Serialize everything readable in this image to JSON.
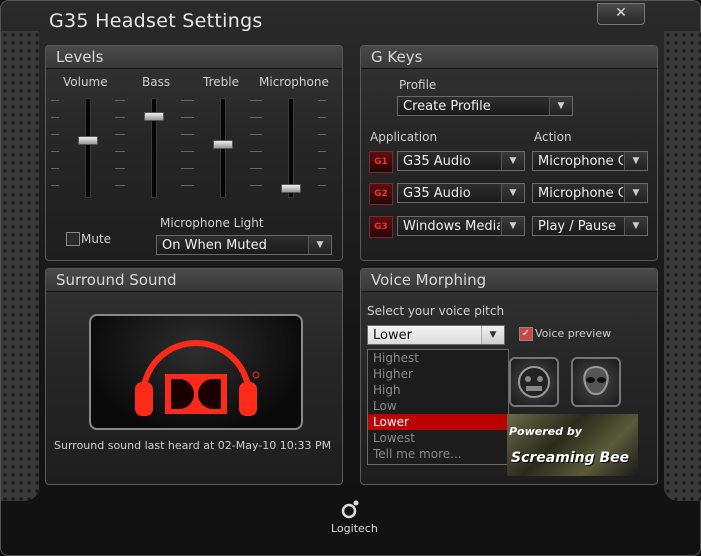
{
  "window": {
    "title": "G35 Headset Settings",
    "close_label": "✕"
  },
  "levels": {
    "title": "Levels",
    "sliders": [
      {
        "label": "Volume",
        "level": 0.58
      },
      {
        "label": "Bass",
        "level": 0.84
      },
      {
        "label": "Treble",
        "level": 0.53
      },
      {
        "label": "Microphone",
        "level": 0.05
      }
    ],
    "mute_label": "Mute",
    "mute_checked": false,
    "mic_light_label": "Microphone Light",
    "mic_light_value": "On When Muted"
  },
  "gkeys": {
    "title": "G Keys",
    "profile_label": "Profile",
    "profile_value": "Create Profile",
    "application_label": "Application",
    "action_label": "Action",
    "rows": [
      {
        "key": "G1",
        "application": "G35 Audio",
        "action": "Microphone Gain"
      },
      {
        "key": "G2",
        "application": "G35 Audio",
        "action": "Microphone Gain"
      },
      {
        "key": "G3",
        "application": "Windows Media Player",
        "action": "Play / Pause"
      }
    ]
  },
  "surround": {
    "title": "Surround Sound",
    "status": "Surround sound last heard at 02-May-10 10:33 PM"
  },
  "voice": {
    "title": "Voice Morphing",
    "pitch_label": "Select your voice pitch",
    "pitch_value": "Lower",
    "preview_label": "Voice preview",
    "preview_checked": true,
    "options": [
      "Highest",
      "Higher",
      "High",
      "Low",
      "Lower",
      "Lowest",
      "Tell me more..."
    ],
    "selected_option": "Lower",
    "powered_by": "Powered by",
    "brand": "Screaming Bee"
  },
  "footer": {
    "logo_text": "Logitech"
  },
  "colors": {
    "accent": "#ff2a1a",
    "panel": "#262626",
    "selection": "#bb0000"
  }
}
